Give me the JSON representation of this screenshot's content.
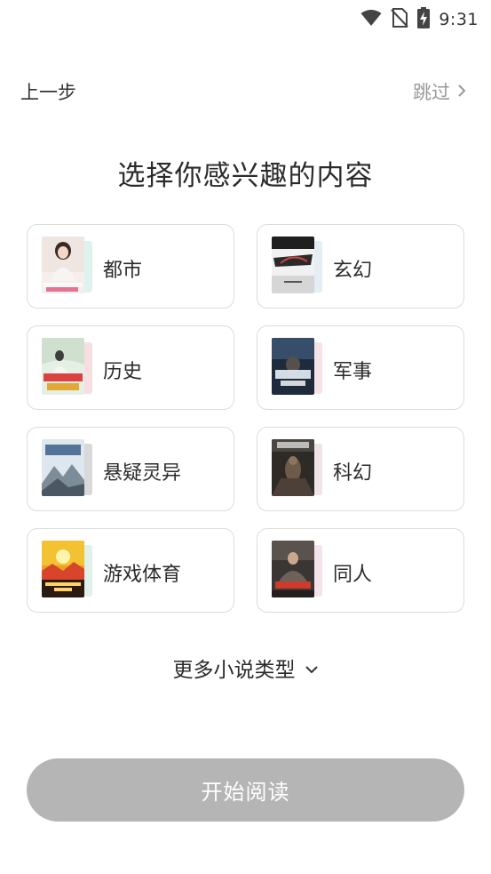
{
  "status_bar": {
    "time": "9:31",
    "icons": [
      "wifi-icon",
      "no-sim-icon",
      "battery-charging-icon"
    ]
  },
  "nav": {
    "back_label": "上一步",
    "skip_label": "跳过"
  },
  "title": "选择你感兴趣的内容",
  "genres": [
    {
      "label": "都市",
      "icon": "book-cover-urban",
      "shadow_color": "#dff3ee"
    },
    {
      "label": "玄幻",
      "icon": "book-cover-fantasy",
      "shadow_color": "#e4eef3"
    },
    {
      "label": "历史",
      "icon": "book-cover-history",
      "shadow_color": "#f6dfe1"
    },
    {
      "label": "军事",
      "icon": "book-cover-military",
      "shadow_color": "#f6e3e8"
    },
    {
      "label": "悬疑灵异",
      "icon": "book-cover-suspense",
      "shadow_color": "#d9d9d9"
    },
    {
      "label": "科幻",
      "icon": "book-cover-scifi",
      "shadow_color": "#f0e4e7"
    },
    {
      "label": "游戏体育",
      "icon": "book-cover-gaming",
      "shadow_color": "#dff1e8"
    },
    {
      "label": "同人",
      "icon": "book-cover-fanfic",
      "shadow_color": "#f4e3ea"
    }
  ],
  "more_types_label": "更多小说类型",
  "start_button_label": "开始阅读",
  "colors": {
    "button_disabled": "#b5b5b5",
    "card_border": "#dcdcdc",
    "secondary_text": "#999999"
  }
}
